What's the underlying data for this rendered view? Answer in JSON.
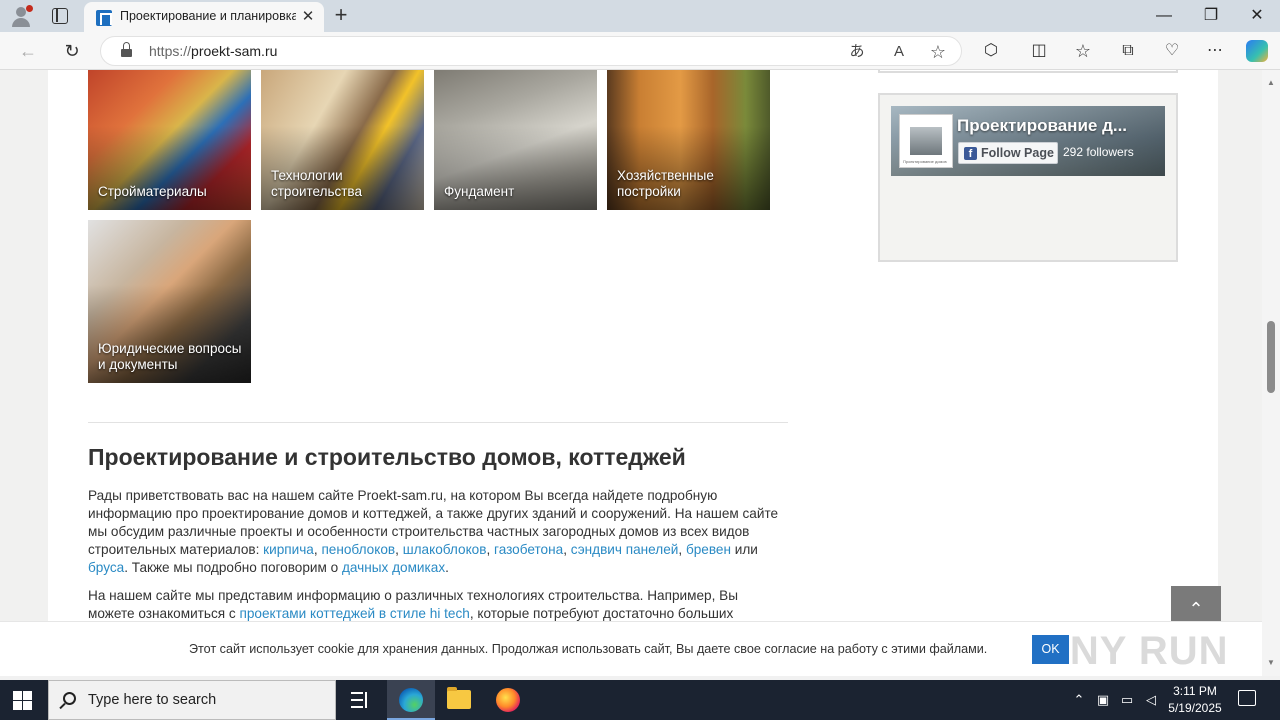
{
  "browser": {
    "tab_title": "Проектирование и планировка",
    "tab_close": "✕",
    "new_tab": "+",
    "url_proto": "https://",
    "url_host": "proekt-sam.ru",
    "window_controls": {
      "minimize": "—",
      "restore": "❐",
      "close": "✕"
    },
    "toolbar_icons": {
      "back": "←",
      "refresh": "↻",
      "translate": "あ",
      "read_aloud": "A",
      "favorite": "☆",
      "extensions": "⬡",
      "split": "◫",
      "favorites": "☆",
      "collections": "⧉",
      "performance": "♡",
      "more": "⋯"
    }
  },
  "categories": [
    {
      "label": "Стройматериалы"
    },
    {
      "label": "Технологии строительства"
    },
    {
      "label": "Фундамент"
    },
    {
      "label": "Хозяйственные постройки"
    },
    {
      "label": "Юридические вопросы и документы"
    }
  ],
  "article": {
    "heading": "Проектирование и строительство домов, коттеджей",
    "p1_text_1": "Рады приветствовать вас на нашем сайте Proekt-sam.ru, на котором Вы всегда найдете подробную информацию про проектирование домов и коттеджей, а также других зданий и сооружений. На нашем сайте мы обсудим различные проекты и особенности строительства частных загородных домов из всех видов строительных материалов: ",
    "p1_link_1": "кирпича",
    "p1_link_2": "пеноблоков",
    "p1_link_3": "шлакоблоков",
    "p1_link_4": "газобетона",
    "p1_link_5": "сэндвич панелей",
    "p1_link_6": "бревен",
    "p1_text_or": " или ",
    "p1_link_7": "бруса",
    "p1_text_2": ". Также мы подробно поговорим о ",
    "p1_link_8": "дачных домиках",
    "p2_text_1": "На нашем сайте мы представим информацию о различных технологиях строительства. Например, Вы можете ознакомиться с ",
    "p2_link_1": "проектами коттеджей в стиле hi tech",
    "p2_text_2": ", которые потребуют достаточно больших"
  },
  "sidebar": {
    "fb_page_name": "Проектирование д...",
    "fb_thumb_caption": "Проектирование домов",
    "fb_follow_label": "Follow Page",
    "fb_followers": "292 followers"
  },
  "scroll_top_icon": "⌃",
  "cookie": {
    "text": "Этот сайт использует cookie для хранения данных. Продолжая использовать сайт, Вы даете свое согласие на работу с этими файлами.",
    "ok_label": "OK",
    "watermark": "ANY RUN"
  },
  "taskbar": {
    "search_placeholder": "Type here to search",
    "time": "3:11 PM",
    "date": "5/19/2025"
  }
}
